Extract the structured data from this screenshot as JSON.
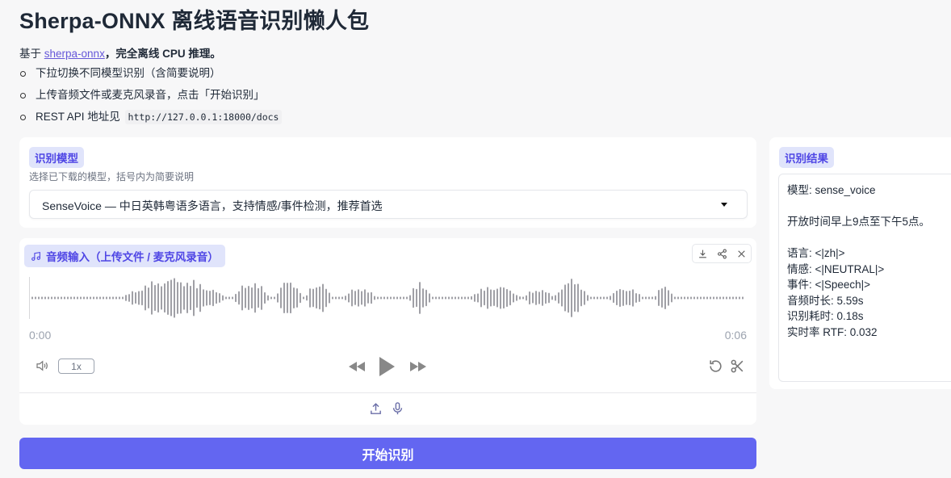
{
  "header": {
    "title": "Sherpa-ONNX 离线语音识别懒人包",
    "intro_prefix": "基于 ",
    "intro_link": "sherpa-onnx",
    "intro_bold": "，完全离线 CPU 推理。",
    "bullets": [
      "下拉切换不同模型识别（含简要说明）",
      "上传音频文件或麦克风录音，点击「开始识别」",
      "REST API 地址见"
    ],
    "api_url": "http://127.0.0.1:18000/docs"
  },
  "model": {
    "label": "识别模型",
    "hint": "选择已下载的模型，括号内为简要说明",
    "selected": "SenseVoice — 中日英韩粤语多语言，支持情感/事件检测，推荐首选"
  },
  "audio": {
    "label": "音频输入（上传文件 / 麦克风录音）",
    "time_start": "0:00",
    "time_end": "0:06",
    "playback_speed": "1x",
    "toolbar_icons": [
      "download-icon",
      "share-icon",
      "close-icon"
    ],
    "control_icons": [
      "volume-icon",
      "rewind-icon",
      "play-icon",
      "fast-forward-icon",
      "reset-icon",
      "trim-icon"
    ],
    "source_icons": [
      "upload-icon",
      "microphone-icon"
    ]
  },
  "action": {
    "start_label": "开始识别"
  },
  "result": {
    "label": "识别结果",
    "model_line": "模型: sense_voice",
    "text_line": "开放时间早上9点至下午5点。",
    "lang_line": "语言: <|zh|>",
    "emotion_line": "情感: <|NEUTRAL|>",
    "event_line": "事件: <|Speech|>",
    "duration_line": "音频时长: 5.59s",
    "elapsed_line": "识别耗时: 0.18s",
    "rtf_line": "实时率 RTF: 0.032"
  },
  "colors": {
    "accent": "#6366f1",
    "chip_bg": "#e0e4fb",
    "chip_text": "#4f46e5",
    "waveform": "#a0a0a6"
  }
}
